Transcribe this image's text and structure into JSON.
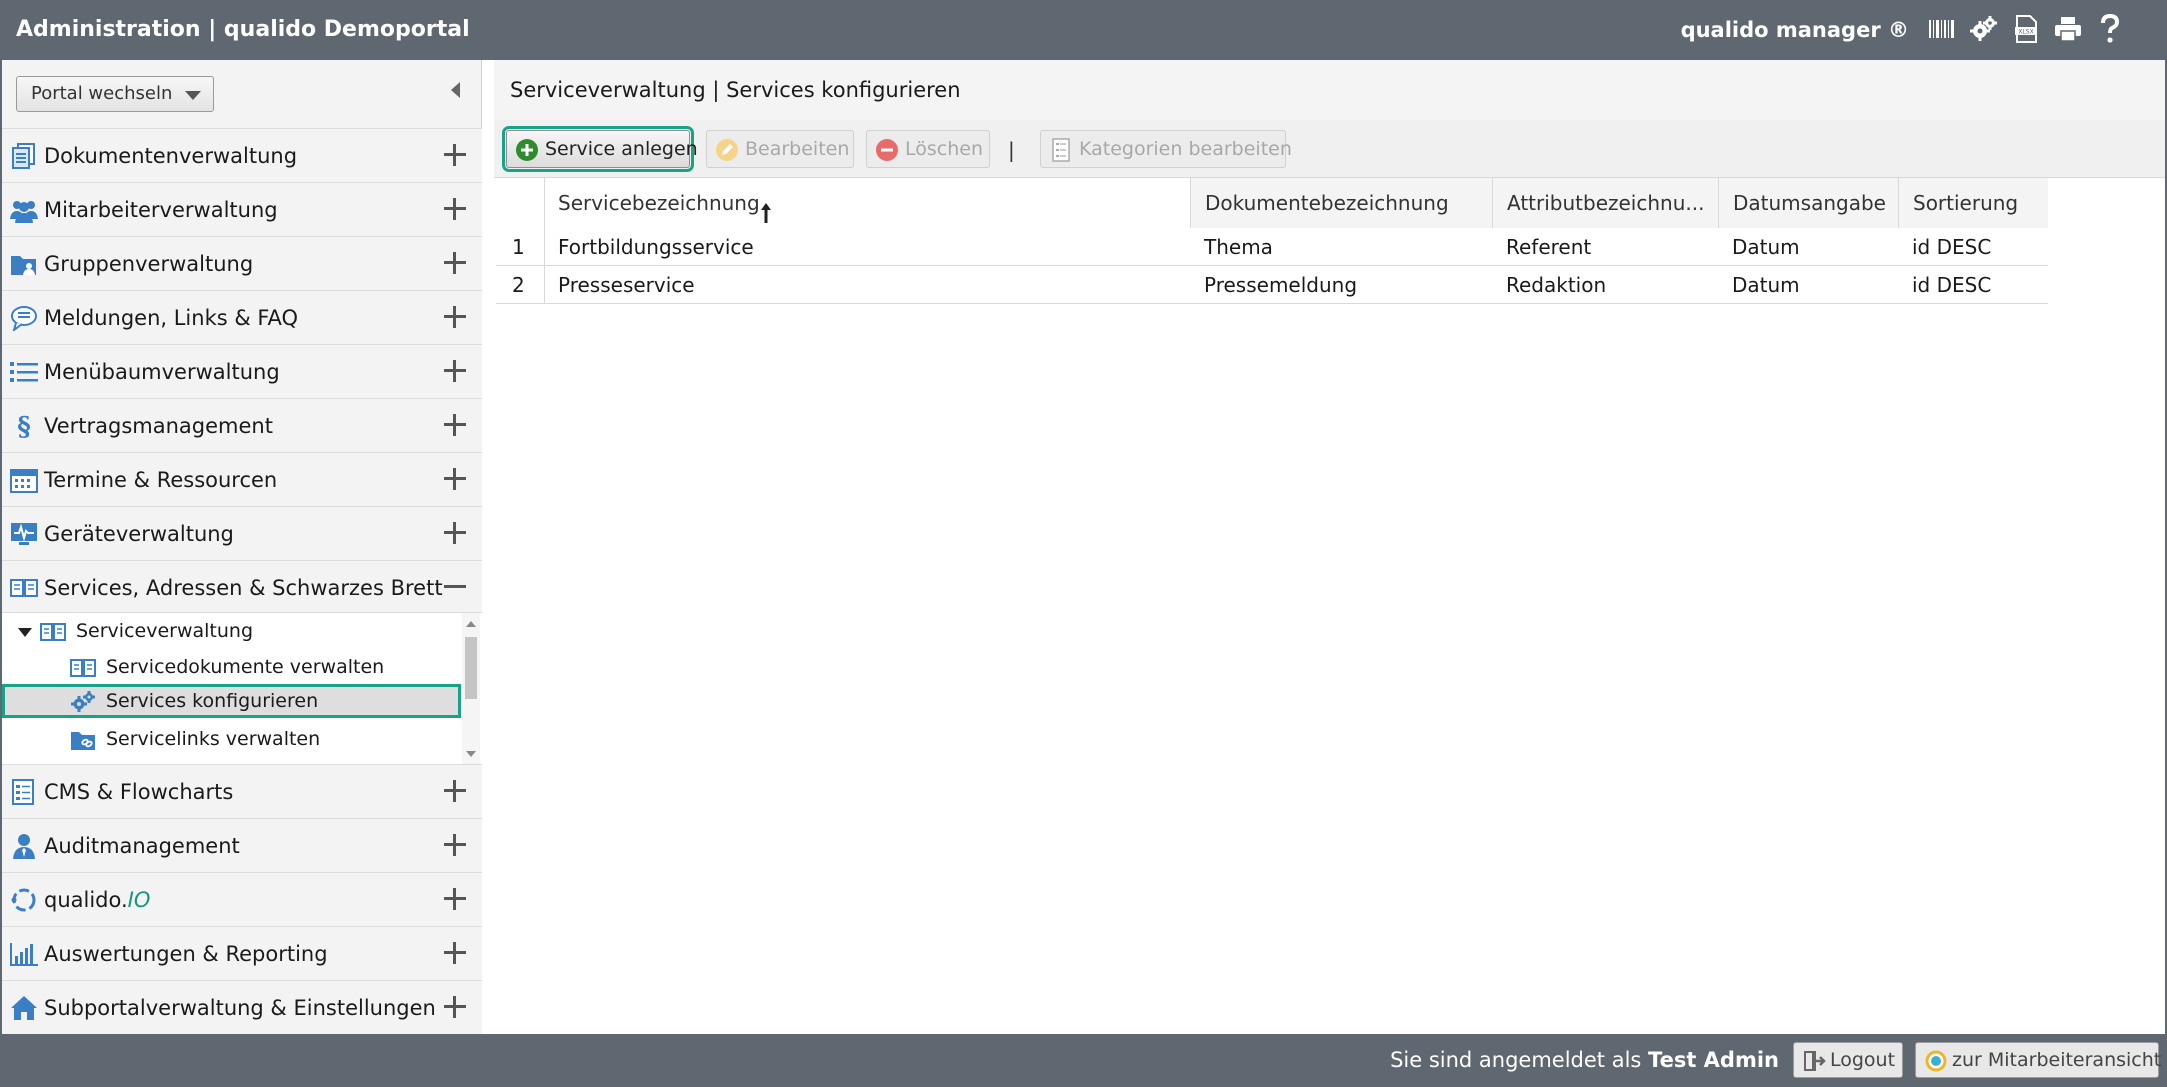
{
  "header": {
    "title": "Administration | qualido Demoportal",
    "brand": "qualido manager ®",
    "icons": [
      "barcode-icon",
      "settings-gears-icon",
      "xlsx-export-icon",
      "print-icon",
      "help-icon"
    ]
  },
  "sidebar": {
    "portal_select": "Portal wechseln",
    "items": [
      {
        "label": "Dokumentenverwaltung",
        "icon": "documents-icon",
        "state": "collapsed"
      },
      {
        "label": "Mitarbeiterverwaltung",
        "icon": "users-icon",
        "state": "collapsed"
      },
      {
        "label": "Gruppenverwaltung",
        "icon": "group-folder-icon",
        "state": "collapsed"
      },
      {
        "label": "Meldungen, Links & FAQ",
        "icon": "chat-bubble-icon",
        "state": "collapsed"
      },
      {
        "label": "Menübaumverwaltung",
        "icon": "list-icon",
        "state": "collapsed"
      },
      {
        "label": "Vertragsmanagement",
        "icon": "paragraph-icon",
        "state": "collapsed"
      },
      {
        "label": "Termine & Ressourcen",
        "icon": "calendar-icon",
        "state": "collapsed"
      },
      {
        "label": "Geräteverwaltung",
        "icon": "device-monitor-icon",
        "state": "collapsed"
      },
      {
        "label": "Services, Adressen & Schwarzes Brett",
        "icon": "open-book-icon",
        "state": "expanded"
      },
      {
        "label": "CMS & Flowcharts",
        "icon": "cms-page-icon",
        "state": "collapsed"
      },
      {
        "label": "Auditmanagement",
        "icon": "auditor-icon",
        "state": "collapsed"
      },
      {
        "label": "qualido.",
        "label_suffix": "IO",
        "icon": "qualido-io-icon",
        "state": "collapsed"
      },
      {
        "label": "Auswertungen & Reporting",
        "icon": "bar-chart-icon",
        "state": "collapsed"
      },
      {
        "label": "Subportalverwaltung & Einstellungen",
        "icon": "home-icon",
        "state": "collapsed"
      }
    ],
    "tree": {
      "parent": "Serviceverwaltung",
      "children": [
        {
          "label": "Servicedokumente verwalten",
          "icon": "open-book-icon",
          "selected": false
        },
        {
          "label": "Services konfigurieren",
          "icon": "gears-icon",
          "selected": true
        },
        {
          "label": "Servicelinks verwalten",
          "icon": "link-folder-icon",
          "selected": false
        }
      ]
    }
  },
  "main": {
    "title": "Serviceverwaltung | Services konfigurieren",
    "toolbar": {
      "create": "Service anlegen",
      "edit": "Bearbeiten",
      "delete": "Löschen",
      "separator": "|",
      "categories": "Kategorien bearbeiten"
    },
    "table": {
      "columns": [
        "Servicebezeichnung",
        "Dokumentebezeichnung",
        "Attributbezeichnu...",
        "Datumsangabe",
        "Sortierung"
      ],
      "sorted_column": "Servicebezeichnung",
      "sort_direction": "ascending",
      "rows": [
        {
          "n": "1",
          "service": "Fortbildungsservice",
          "doc": "Thema",
          "attr": "Referent",
          "date": "Datum",
          "sort": "id DESC"
        },
        {
          "n": "2",
          "service": "Presseservice",
          "doc": "Pressemeldung",
          "attr": "Redaktion",
          "date": "Datum",
          "sort": "id DESC"
        }
      ]
    }
  },
  "footer": {
    "login_prefix": "Sie sind angemeldet als",
    "user": "Test Admin",
    "logout": "Logout",
    "employee_view": "zur Mitarbeiteransicht"
  },
  "colors": {
    "header_bg": "#5f6770",
    "accent": "#17a289",
    "create_icon": "#2e8b2e",
    "delete_icon": "#e05050",
    "nav_icon": "#3a7fc4"
  }
}
